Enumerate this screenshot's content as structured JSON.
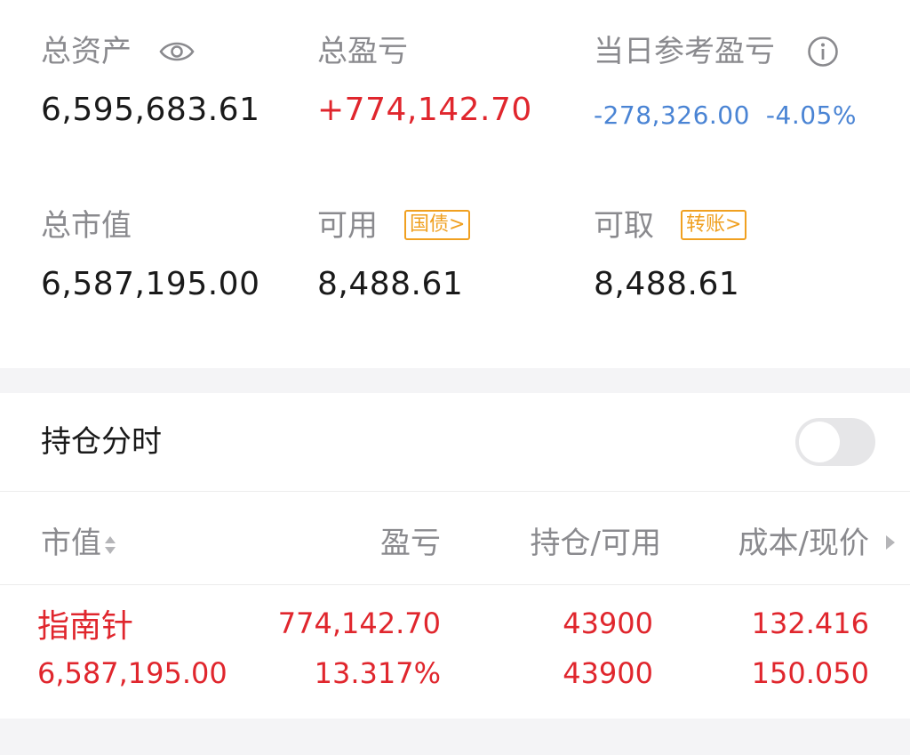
{
  "summary": {
    "total_assets": {
      "label": "总资产",
      "value": "6,595,683.61"
    },
    "total_pnl": {
      "label": "总盈亏",
      "value": "+774,142.70"
    },
    "daily_pnl": {
      "label": "当日参考盈亏",
      "value": "-278,326.00",
      "percent": "-4.05%"
    },
    "market_value": {
      "label": "总市值",
      "value": "6,587,195.00"
    },
    "available": {
      "label": "可用",
      "tag": "国债>",
      "value": "8,488.61"
    },
    "withdrawable": {
      "label": "可取",
      "tag": "转账>",
      "value": "8,488.61"
    }
  },
  "positions": {
    "toggle_label": "持仓分时",
    "toggle_on": false,
    "columns": {
      "market_value": "市值",
      "pnl": "盈亏",
      "holding": "持仓/可用",
      "cost_price": "成本/现价"
    },
    "rows": [
      {
        "name": "指南针",
        "market_value": "6,587,195.00",
        "pnl": "774,142.70",
        "pnl_percent": "13.317%",
        "holding": "43900",
        "available": "43900",
        "cost": "132.416",
        "price": "150.050"
      }
    ]
  },
  "colors": {
    "red": "#e0262d",
    "blue": "#4a84d4",
    "orange": "#f0a020",
    "label_gray": "#8a8a8e"
  }
}
